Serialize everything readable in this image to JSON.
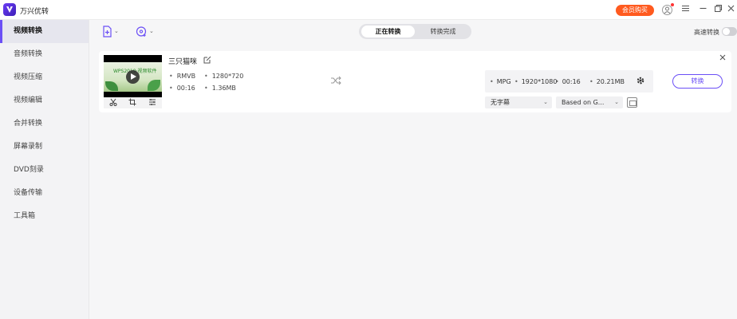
{
  "app": {
    "title": "万兴优转"
  },
  "header": {
    "vip_label": "会员购买"
  },
  "sidebar": {
    "items": [
      {
        "label": "视频转换",
        "active": true
      },
      {
        "label": "音频转换"
      },
      {
        "label": "视频压缩"
      },
      {
        "label": "视频编辑"
      },
      {
        "label": "合并转换"
      },
      {
        "label": "屏幕录制"
      },
      {
        "label": "DVD刻录"
      },
      {
        "label": "设备传输"
      },
      {
        "label": "工具箱"
      }
    ]
  },
  "toolbar": {
    "tabs": [
      {
        "label": "正在转换",
        "active": true
      },
      {
        "label": "转换完成"
      }
    ],
    "high_speed_label": "高速转换",
    "high_speed_on": false
  },
  "file": {
    "name": "三只猫咪",
    "thumb_text": "WPS2019·视频软件",
    "source": {
      "format": "RMVB",
      "resolution": "1280*720",
      "duration": "00:16",
      "size": "1.36MB"
    },
    "output": {
      "format": "MPG",
      "resolution": "1920*1080",
      "duration": "00:16",
      "size": "20.21MB"
    },
    "subtitle": "无字幕",
    "audio": "Based on G...",
    "convert_label": "转换"
  },
  "colors": {
    "accent": "#6b4ff6",
    "vip": "#ff5a1f"
  }
}
